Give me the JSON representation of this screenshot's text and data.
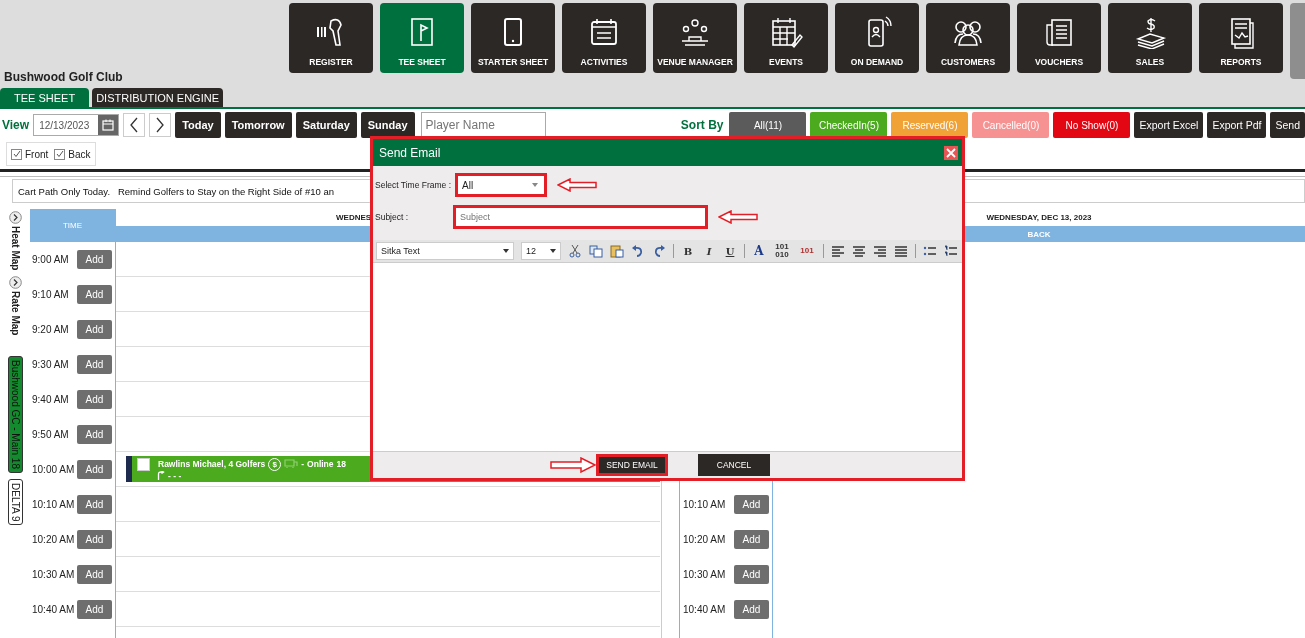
{
  "nav": [
    {
      "label": "REGISTER",
      "selected": false
    },
    {
      "label": "TEE SHEET",
      "selected": true
    },
    {
      "label": "STARTER SHEET",
      "selected": false
    },
    {
      "label": "ACTIVITIES",
      "selected": false
    },
    {
      "label": "VENUE MANAGER",
      "selected": false
    },
    {
      "label": "EVENTS",
      "selected": false
    },
    {
      "label": "ON DEMAND",
      "selected": false
    },
    {
      "label": "CUSTOMERS",
      "selected": false
    },
    {
      "label": "VOUCHERS",
      "selected": false
    },
    {
      "label": "SALES",
      "selected": false
    },
    {
      "label": "REPORTS",
      "selected": false
    }
  ],
  "club_name": "Bushwood Golf Club",
  "tabs": [
    {
      "label": "TEE SHEET",
      "selected": true
    },
    {
      "label": "DISTRIBUTION ENGINE",
      "selected": false
    }
  ],
  "toolbar": {
    "view_label": "View",
    "date": "12/13/2023",
    "day_buttons": [
      "Today",
      "Tomorrow",
      "Saturday",
      "Sunday"
    ],
    "player_search": {
      "placeholder": "Player Name"
    },
    "sort_label": "Sort By",
    "filters": [
      {
        "label": "All(11)",
        "color": "#5b5b5b"
      },
      {
        "label": "CheckedIn(5)",
        "color": "#4caa1e"
      },
      {
        "label": "Reserved(6)",
        "color": "#f0a236"
      },
      {
        "label": "Cancelled(0)",
        "color": "#f79292"
      },
      {
        "label": "No Show(0)",
        "color": "#e30613"
      }
    ],
    "actions": [
      "Export Excel",
      "Export Pdf",
      "Send"
    ]
  },
  "views": [
    {
      "label": "Front",
      "checked": true
    },
    {
      "label": "Back",
      "checked": true
    }
  ],
  "message": "Cart Path Only Today.   Remind Golfers to Stay on the Right Side of #10 an",
  "map_toggles": [
    "Heat Map",
    "Rate Map"
  ],
  "courses": [
    {
      "label": "Bushwood GC - Main 18",
      "selected": true
    },
    {
      "label": "DELTA 9",
      "selected": false
    }
  ],
  "tee_sheet": {
    "time_header": "TIME",
    "front": {
      "date_header": "WEDNES",
      "rows": [
        {
          "time": "9:00 AM",
          "add": "Add"
        },
        {
          "time": "9:10 AM",
          "add": "Add"
        },
        {
          "time": "9:20 AM",
          "add": "Add"
        },
        {
          "time": "9:30 AM",
          "add": "Add"
        },
        {
          "time": "9:40 AM",
          "add": "Add"
        },
        {
          "time": "9:50 AM",
          "add": "Add"
        },
        {
          "time": "10:00 AM",
          "add": "Add",
          "booking": {
            "checked": false,
            "name": "Rawlins Michael, 4 Golfers",
            "payment": "$",
            "separator": "-",
            "source": "Online",
            "holes": "18",
            "detail": "- - -"
          }
        },
        {
          "time": "10:10 AM",
          "add": "Add"
        },
        {
          "time": "10:20 AM",
          "add": "Add"
        },
        {
          "time": "10:30 AM",
          "add": "Add"
        },
        {
          "time": "10:40 AM",
          "add": "Add"
        }
      ]
    },
    "back": {
      "date_header": "WEDNESDAY, DEC 13, 2023",
      "side_label": "BACK",
      "rows": [
        {
          "time": "10:10 AM",
          "add": "Add"
        },
        {
          "time": "10:20 AM",
          "add": "Add"
        },
        {
          "time": "10:30 AM",
          "add": "Add"
        },
        {
          "time": "10:40 AM",
          "add": "Add"
        }
      ]
    }
  },
  "dialog": {
    "title": "Send Email",
    "time_frame": {
      "label": "Select Time Frame :",
      "value": "All",
      "highlighted": true
    },
    "subject": {
      "label": "Subject :",
      "placeholder": "Subject",
      "highlighted": true
    },
    "editor": {
      "font": "Sitka Text",
      "size": "12",
      "format_tools": [
        "B",
        "I",
        "U"
      ],
      "color_tool": "A",
      "code_tools": [
        "101 010",
        "101"
      ]
    },
    "buttons": [
      {
        "label": "SEND EMAIL",
        "highlighted": true
      },
      {
        "label": "CANCEL",
        "highlighted": false
      }
    ]
  }
}
